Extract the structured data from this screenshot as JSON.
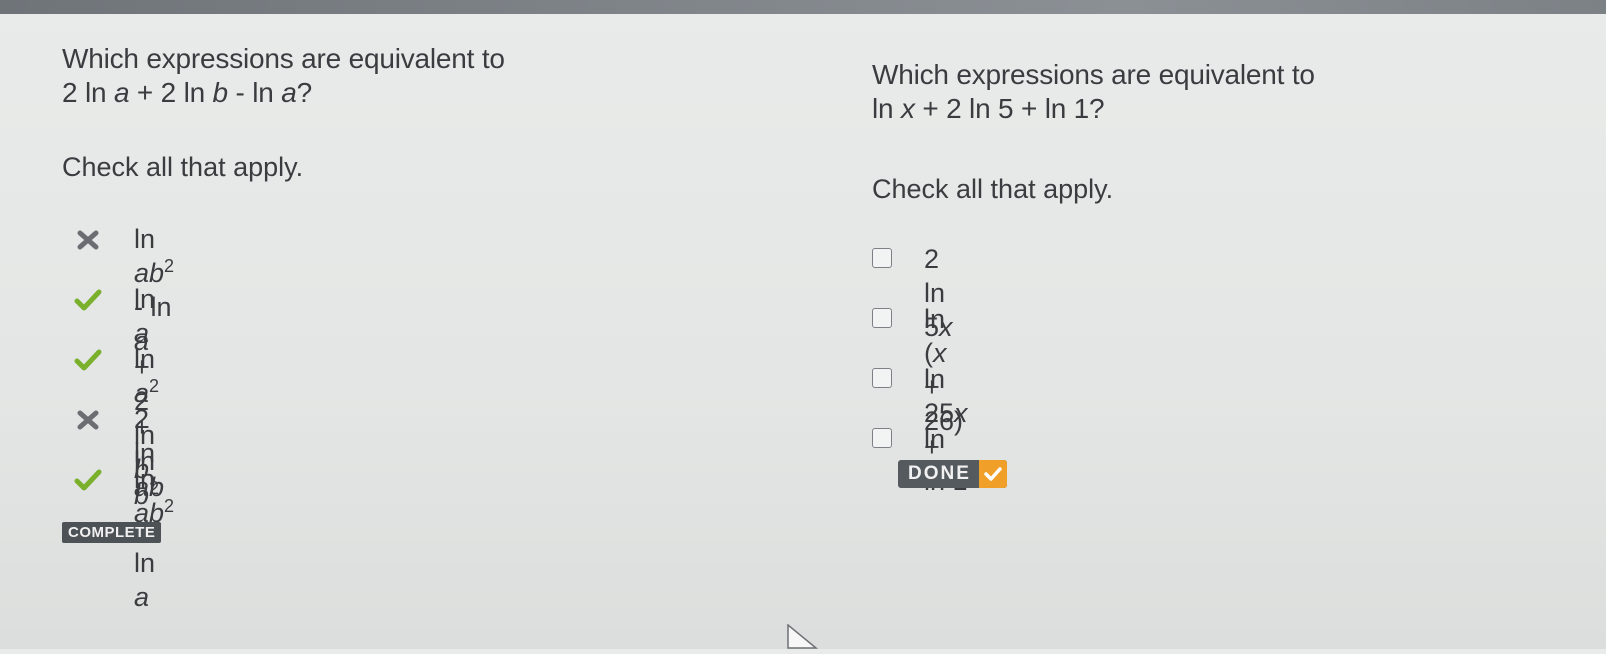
{
  "colors": {
    "correct": "#7ab02c",
    "incorrect": "#6a6e73",
    "done_check": "#f0a028"
  },
  "left": {
    "question_line1": "Which expressions are equivalent to",
    "question_expr": [
      "2 ln ",
      "a",
      " + 2 ln ",
      "b",
      " - ln ",
      "a",
      "?"
    ],
    "instruction": "Check all that apply.",
    "options": [
      {
        "status": "incorrect",
        "icon": "x-mark-icon",
        "parts": [
          "ln ",
          "ab",
          "2",
          " - ln ",
          "a"
        ]
      },
      {
        "status": "correct",
        "icon": "check-mark-icon",
        "parts": [
          "ln ",
          "a",
          " + 2 ln ",
          "b"
        ]
      },
      {
        "status": "correct",
        "icon": "check-mark-icon",
        "parts": [
          "ln ",
          "a",
          "2",
          " + ln ",
          "b",
          "2",
          " - ln ",
          "a"
        ]
      },
      {
        "status": "incorrect",
        "icon": "x-mark-icon",
        "parts": [
          "2 ln ",
          "ab"
        ]
      },
      {
        "status": "correct",
        "icon": "check-mark-icon",
        "parts": [
          "ln ",
          "ab",
          "2"
        ]
      }
    ],
    "badge": "COMPLETE"
  },
  "right": {
    "question_line1": "Which expressions are equivalent to",
    "question_expr": [
      "ln ",
      "x",
      " + 2 ln 5 + ln 1?"
    ],
    "instruction": "Check all that apply.",
    "options": [
      {
        "checked": false,
        "parts": [
          "2 ln 5",
          "x"
        ]
      },
      {
        "checked": false,
        "parts": [
          "ln (",
          "x",
          " + 26)"
        ]
      },
      {
        "checked": false,
        "parts": [
          "ln 25",
          "x",
          " + ln 1"
        ]
      },
      {
        "checked": false,
        "parts": [
          "ln 25",
          "x"
        ]
      }
    ],
    "done_label": "DONE"
  }
}
